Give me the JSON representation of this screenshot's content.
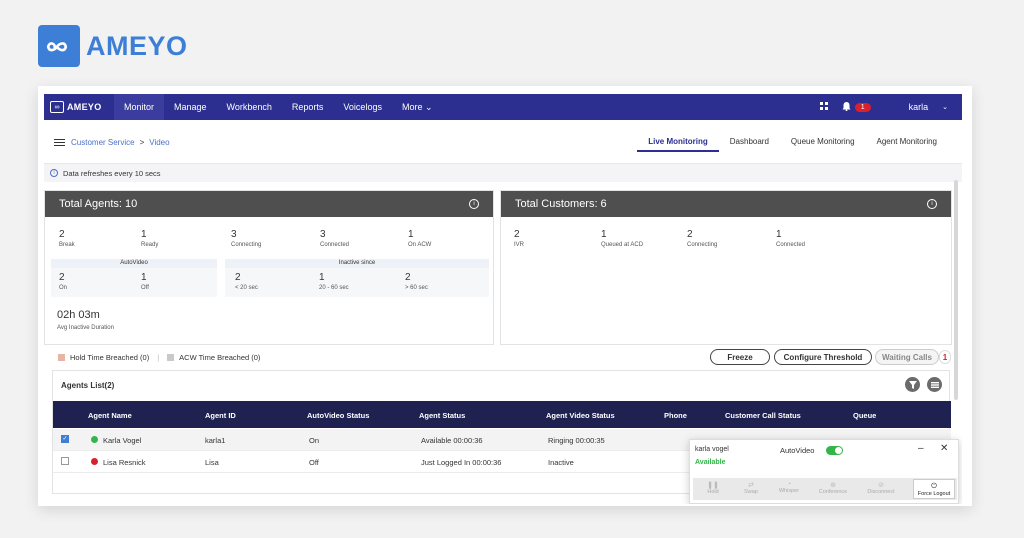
{
  "brand": {
    "name": "AMEYO"
  },
  "navbar": {
    "logo": "AMEYO",
    "items": [
      "Monitor",
      "Manage",
      "Workbench",
      "Reports",
      "Voicelogs",
      "More ⌄"
    ],
    "notification_count": "1",
    "user": "karla"
  },
  "breadcrumb": {
    "root": "Customer Service",
    "sep": ">",
    "leaf": "Video"
  },
  "tabs": [
    "Live Monitoring",
    "Dashboard",
    "Queue Monitoring",
    "Agent Monitoring"
  ],
  "refresh_text": "Data refreshes every 10 secs",
  "agents_card": {
    "title": "Total Agents:",
    "total": "10",
    "stats": [
      {
        "n": "2",
        "l": "Break"
      },
      {
        "n": "1",
        "l": "Ready"
      },
      {
        "n": "3",
        "l": "Connecting"
      },
      {
        "n": "3",
        "l": "Connected"
      },
      {
        "n": "1",
        "l": "On ACW"
      }
    ],
    "autovideo": {
      "title": "AutoVideo",
      "items": [
        {
          "n": "2",
          "l": "On"
        },
        {
          "n": "1",
          "l": "Off"
        }
      ]
    },
    "inactive": {
      "title": "Inactive since",
      "items": [
        {
          "n": "2",
          "l": "< 20 sec"
        },
        {
          "n": "1",
          "l": "20 - 60 sec"
        },
        {
          "n": "2",
          "l": "> 60 sec"
        }
      ]
    },
    "avg": {
      "value": "02h 03m",
      "label": "Avg Inactive Duration"
    }
  },
  "customers_card": {
    "title": "Total Customers:",
    "total": "6",
    "stats": [
      {
        "n": "2",
        "l": "IVR"
      },
      {
        "n": "1",
        "l": "Queued at ACD"
      },
      {
        "n": "2",
        "l": "Connecting"
      },
      {
        "n": "1",
        "l": "Connected"
      }
    ]
  },
  "legend": {
    "hold": "Hold Time Breached (0)",
    "acw": "ACW Time Breached (0)"
  },
  "actions": {
    "freeze": "Freeze",
    "threshold": "Configure Threshold",
    "waiting": "Waiting Calls",
    "waiting_count": "1"
  },
  "agents_list": {
    "title": "Agents List(2)",
    "columns": [
      "Agent Name",
      "Agent ID",
      "AutoVideo Status",
      "Agent Status",
      "Agent Video Status",
      "Phone",
      "Customer Call Status",
      "Queue"
    ],
    "rows": [
      {
        "name": "Karla Vogel",
        "id": "karla1",
        "autovideo": "On",
        "status": "Available 00:00:36",
        "video": "Ringing 00:00:35"
      },
      {
        "name": "Lisa Resnick",
        "id": "Lisa",
        "autovideo": "Off",
        "status": "Just Logged In 00:00:36",
        "video": "Inactive"
      }
    ]
  },
  "popup": {
    "name": "karla vogel",
    "status": "Available",
    "autovideo_label": "AutoVideo",
    "buttons": [
      "Hold",
      "Swap",
      "Whisper",
      "Conference",
      "Disconnect"
    ],
    "force_logout": "Force Logout"
  },
  "colors": {
    "brand": "#3d7fd6",
    "navbar": "#2c2f8f",
    "table_header": "#1f2250",
    "available": "#33b54a",
    "busy": "#d9212e"
  }
}
